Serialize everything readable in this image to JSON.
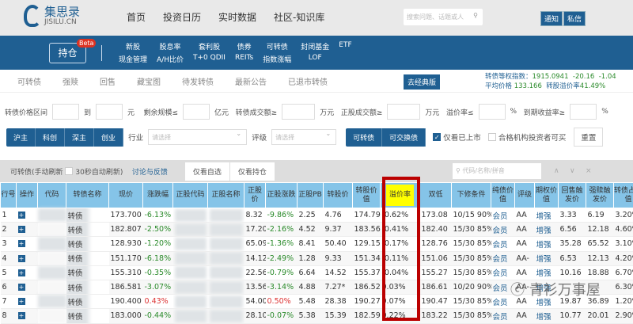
{
  "header": {
    "logo_cn": "集思录",
    "logo_en": "JISILU.CN",
    "nav": [
      "首页",
      "投资日历",
      "实时数据",
      "社区-知识库"
    ],
    "search_placeholder": "搜索问题、话题或人",
    "notify": "通知",
    "message": "私信"
  },
  "bluebar": {
    "hold": "持仓",
    "beta": "Beta",
    "menu": [
      "新股",
      "股息率",
      "套利股",
      "债券",
      "可转债",
      "封闭基金",
      "ETF",
      "现金管理",
      "A/H比价",
      "T+0 QDII",
      "REITs",
      "指数涨幅",
      "LOF",
      ""
    ]
  },
  "tabs": {
    "items": [
      "可转债",
      "强赎",
      "回售",
      "藏宝图",
      "待发转债",
      "最新公告",
      "已退市转债"
    ],
    "classic": "去经典版",
    "index_label": "转债等权指数：",
    "index_value": "1915.0941",
    "index_change": "-20.16",
    "index_pct": "-1.04",
    "avg_price_label": "平均价格",
    "avg_price": "133.166",
    "premium_label": "转股溢价率",
    "premium": "41.49%"
  },
  "filters": {
    "price_range": "转债价格区间",
    "to": "到",
    "yuan": "元",
    "remain": "剩余规模≤",
    "yi": "亿元",
    "bond_vol": "转债成交额≥",
    "wan1": "万元",
    "stock_vol": "正股成交额≥",
    "wan2": "万元",
    "premium": "溢价率≤",
    "pct": "%",
    "ytm": "到期收益率≥",
    "pct2": "%"
  },
  "row2": {
    "markets": [
      "沪主",
      "科创",
      "深主",
      "创业"
    ],
    "industry": "行业",
    "industry_ph": "请选择",
    "rating": "评级",
    "rating_ph": "请选择",
    "types": [
      "可转债",
      "可交换债"
    ],
    "listed_only": "仅看已上市",
    "qualified": "合格机构投资者可买",
    "reset": "重置"
  },
  "toolbar": {
    "title": "可转债(手动刷新",
    "auto": "30秒自动刷新)",
    "feedback": "讨论与反馈",
    "my_select": "仅看自选",
    "my_hold": "仅看持仓",
    "search_ph": "代码/名称/拼音",
    "up": "∧",
    "down": "∨",
    "close": "×"
  },
  "table": {
    "headers": [
      "行号",
      "操作",
      "代码",
      "转债名称",
      "现价",
      "涨跌幅",
      "正股代码",
      "正股名称",
      "正股价",
      "正股涨跌",
      "正股PB",
      "转股价",
      "转股价值",
      "溢价率",
      "双低",
      "下修条件",
      "纯债价值",
      "评级",
      "期权价值",
      "回售触发价",
      "强赎触发价",
      "转债占市值"
    ],
    "rows": [
      [
        "1",
        "11",
        "转债",
        "173.700",
        "-6.13%",
        "8.32",
        "-9.86%",
        "2.25",
        "4.76",
        "174.79",
        "-0.62%",
        "173.08",
        "10/15 90%",
        "会员",
        "AA",
        "增强",
        "3.33",
        "6.19",
        "3.20%"
      ],
      [
        "2",
        "11",
        "转债",
        "182.807",
        "-2.50%",
        "17.20",
        "-2.16%",
        "4.52",
        "9.37",
        "183.56",
        "-0.41%",
        "182.40",
        "15/30 85%",
        "会员",
        "AA",
        "增强",
        "6.56",
        "12.18",
        "4.60%"
      ],
      [
        "3",
        "11",
        "转债",
        "128.930",
        "-1.20%",
        "65.09",
        "-1.36%",
        "8.41",
        "50.40",
        "129.15",
        "-0.17%",
        "128.76",
        "15/30 85%",
        "会员",
        "AA",
        "增强",
        "35.28",
        "65.52",
        "3.10%"
      ],
      [
        "4",
        "11",
        "转债",
        "151.170",
        "-6.18%",
        "14.12",
        "-2.49%",
        "1.28",
        "9.33",
        "151.34",
        "-0.11%",
        "151.06",
        "15/30 85%",
        "会员",
        "AA-",
        "增强",
        "6.53",
        "12.13",
        "4.20%"
      ],
      [
        "5",
        "11",
        "转债",
        "155.310",
        "-0.35%",
        "22.56",
        "-0.79%",
        "6.64",
        "14.52",
        "155.37",
        "-0.04%",
        "155.27",
        "15/30 85%",
        "会员",
        "AA",
        "增强",
        "10.16",
        "18.88",
        "6.70%"
      ],
      [
        "6",
        "12",
        "转债",
        "186.581",
        "-3.07%",
        "13.56",
        "-3.14%",
        "4.88",
        "7.27*",
        "186.52",
        "0.03%",
        "186.61",
        "10/20 90%",
        "会员",
        "AA-",
        "增强",
        "",
        "",
        "6.30%"
      ],
      [
        "7",
        "11",
        "转债",
        "190.400",
        "0.43%",
        "54.00",
        "0.50%",
        "5.48",
        "28.38",
        "190.27",
        "0.07%",
        "190.47",
        "15/30 85%",
        "会员",
        "AA",
        "增强",
        "19.87",
        "36.89",
        "1.20%"
      ],
      [
        "8",
        "12",
        "转债",
        "183.000",
        "-0.44%",
        "28.10",
        "-0.07%",
        "5.38",
        "15.39",
        "182.59",
        "0.22%",
        "183.22",
        "15/30 85%",
        "会员",
        "AA",
        "增强",
        "10.77",
        "20.01",
        "2.90%"
      ]
    ]
  },
  "watermark": "青衫万事屋"
}
